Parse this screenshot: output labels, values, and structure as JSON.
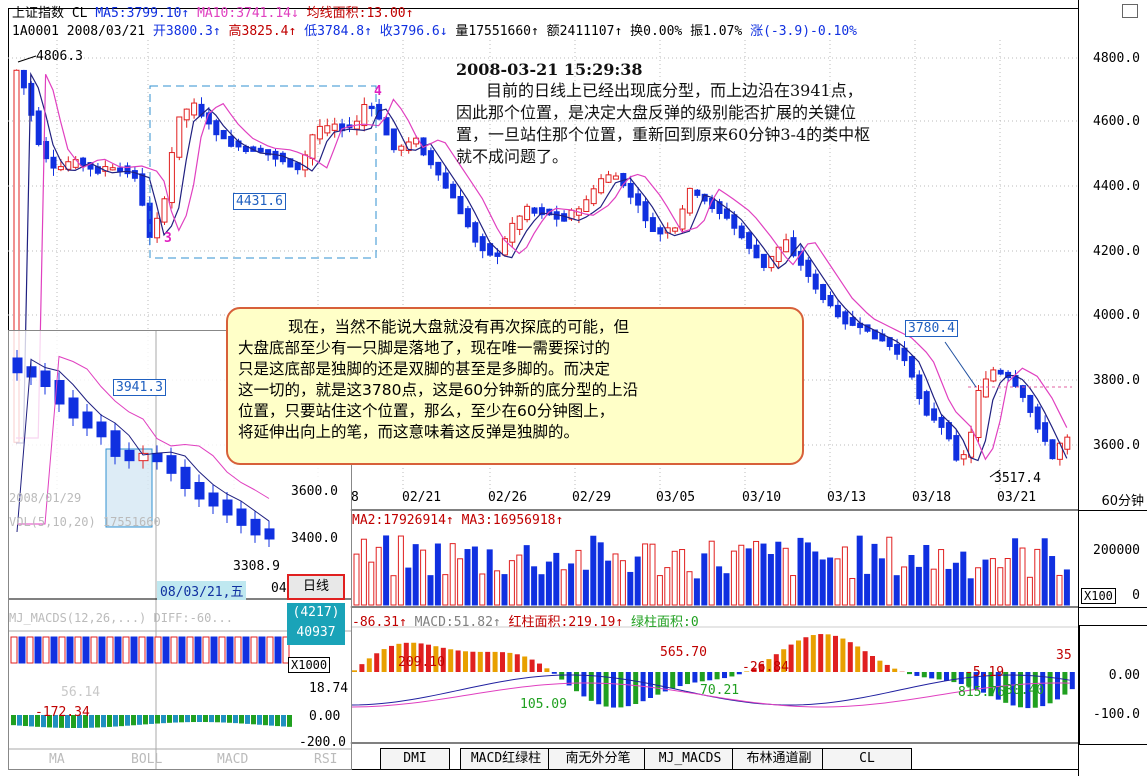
{
  "header": {
    "line1": {
      "name": "上证指数 CL",
      "ma5": "MA5:3799.10↑",
      "ma10": "MA10:3741.14↓",
      "ma_area": "均线面积:13.00↑"
    },
    "line2": {
      "code_date": "1A0001 2008/03/21",
      "open": "开3800.3↑",
      "high": "高3825.4↑",
      "low": "低3784.8↑",
      "close": "收3796.6↓",
      "volume": "量17551660↑",
      "amount": "额2411107↑",
      "turnover": "换0.00%",
      "amplitude": "振1.07%",
      "change": "涨(-3.9)-0.10%"
    }
  },
  "price_axis": [
    "4800.0",
    "4600.0",
    "4400.0",
    "4200.0",
    "4000.0",
    "3800.0",
    "3600.0",
    "60分钟"
  ],
  "annotations": {
    "timestamp": "2008-03-21 15:29:38",
    "note_lines": [
      "目前的日线上已经出现底分型，而上边沿在3941点，",
      "因此那个位置，是决定大盘反弹的级别能否扩展的关键位",
      "置，一旦站住那个位置，重新回到原来60分钟3-4的类中枢",
      "就不成问题了。"
    ],
    "callout_lines": [
      "现在，当然不能说大盘就没有再次探底的可能，但",
      "大盘底部至少有一只脚是落地了，现在唯一需要探讨的",
      "只是这底部是独脚的还是双脚的甚至是多脚的。而决定",
      "这一切的，就是这3780点，这是60分钟新的底分型的上沿",
      "位置，只要站住这个位置，那么，至少在60分钟图上，",
      "将延伸出向上的笔，而这意味着这反弹是独脚的。"
    ],
    "high_label": "4806.3",
    "mark_3": "3",
    "mark_4": "4",
    "box_4431": "4431.6",
    "box_3941": "3941.3",
    "box_3780": "3780.4",
    "low_label": "3517.4",
    "inset_low": "3308.9"
  },
  "date_axis": [
    "02/21",
    "02/26",
    "02/29",
    "03/05",
    "03/10",
    "03/13",
    "03/18",
    "03/21"
  ],
  "volume": {
    "label": "MA2:17926914↑ MA3:16956918↑",
    "axis": [
      "200000",
      "X100",
      "0"
    ]
  },
  "macd": {
    "label_prefix": "-86.31↑",
    "label_macd": "MACD:51.82↑",
    "label_red": "红柱面积:219.19↑",
    "label_green": "绿柱面积:0",
    "axis": [
      "0.00",
      "-100.0"
    ],
    "values": [
      "209.10",
      "565.70",
      "-26.84",
      "105.09",
      "70.21",
      "815.76",
      "-5.19",
      "30.40",
      "35"
    ]
  },
  "inset": {
    "axis": [
      "3600.0",
      "3400.0"
    ],
    "date_line": "08/03/21,五",
    "mode_button": "日线",
    "stat1": "(4217)",
    "stat2": "40937",
    "x1000": "X1000",
    "macd_axis": [
      "18.74",
      "0.00",
      "-200.0"
    ],
    "vals": [
      "56.14",
      "-172.34"
    ],
    "faded_date": "2008/01/29",
    "faded_vol": "VOL(5,10,20) 17551660",
    "faded_macd": "MJ_MACDS(12,26,...) DIFF:-60...",
    "tabs": [
      "MA",
      "BOLL",
      "MACD",
      "RSI"
    ]
  },
  "bottom_tabs": [
    "DMI",
    "MACD红绿柱",
    "南无外分笔",
    "MJ_MACDS",
    "布林通道副",
    "CL"
  ],
  "colors": {
    "up": "#e02020",
    "down": "#1030e0",
    "ma": "#202080",
    "ma_alt": "#e040c0",
    "green": "#20a020",
    "callout_border": "#d7603a",
    "callout_bg": "#ffffc8"
  }
}
